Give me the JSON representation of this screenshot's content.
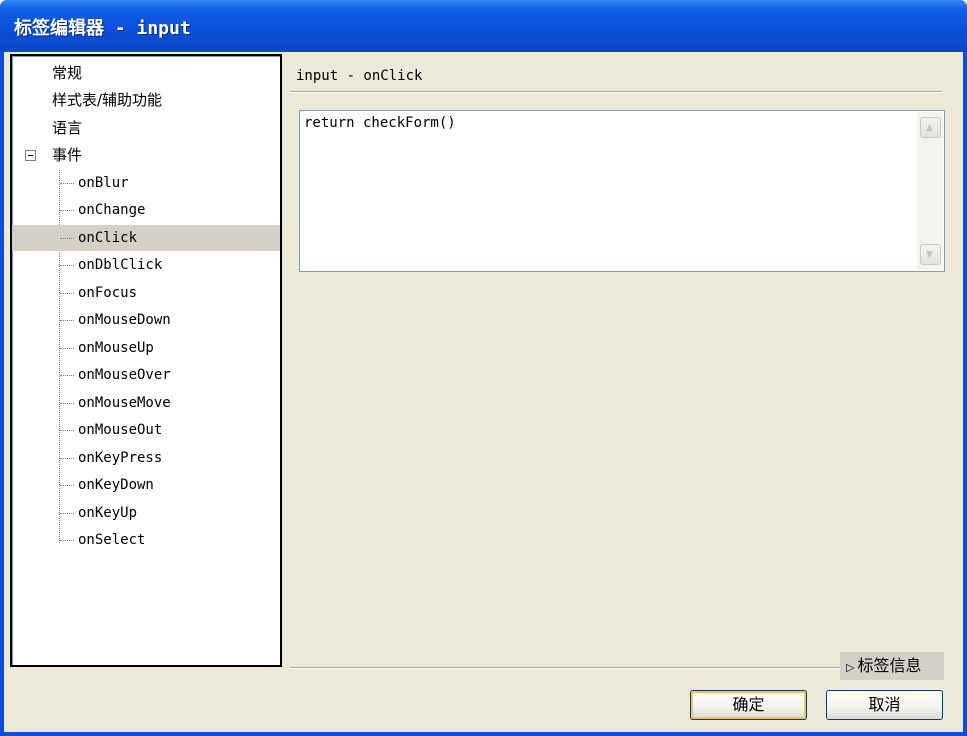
{
  "window": {
    "title": "标签编辑器 - input"
  },
  "tree": {
    "top_items": [
      {
        "label": "常规"
      },
      {
        "label": "样式表/辅助功能"
      },
      {
        "label": "语言"
      },
      {
        "label": "事件",
        "expanded": true
      }
    ],
    "events": [
      "onBlur",
      "onChange",
      "onClick",
      "onDblClick",
      "onFocus",
      "onMouseDown",
      "onMouseUp",
      "onMouseOver",
      "onMouseMove",
      "onMouseOut",
      "onKeyPress",
      "onKeyDown",
      "onKeyUp",
      "onSelect"
    ],
    "selected": "onClick"
  },
  "main": {
    "section_title": "input - onClick",
    "code_value": "return checkForm()"
  },
  "footer": {
    "tag_info_label": "标签信息",
    "ok_label": "确定",
    "cancel_label": "取消"
  },
  "colors": {
    "titlebar": "#0a4fd6",
    "dialog_bg": "#ece9d8",
    "selection": "#d4d0c8"
  }
}
